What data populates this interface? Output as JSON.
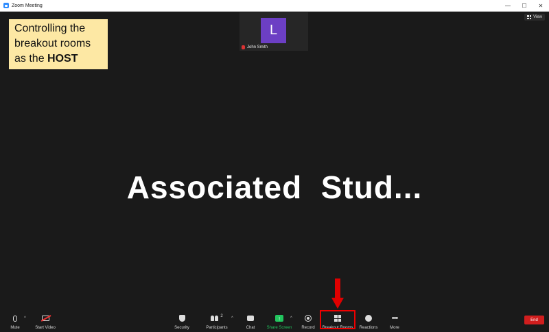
{
  "window": {
    "title": "Zoom Meeting",
    "controls": [
      "—",
      "☐",
      "✕"
    ]
  },
  "view_button": {
    "label": "View"
  },
  "callout": {
    "line1": "Controlling the",
    "line2": "breakout rooms",
    "line3_prefix": "as the ",
    "line3_bold": "HOST"
  },
  "participant_tile": {
    "initial": "L",
    "name": "John Smith"
  },
  "shared_screen": {
    "title": "Associated  Stud..."
  },
  "toolbar": {
    "mute": "Mute",
    "start_video": "Start Video",
    "security": "Security",
    "participants": "Participants",
    "participants_count": "2",
    "chat": "Chat",
    "share_screen": "Share Screen",
    "record": "Record",
    "breakout_rooms": "Breakout Rooms",
    "reactions": "Reactions",
    "more": "More",
    "end": "End",
    "caret": "^"
  },
  "colors": {
    "share_green": "#22c55e",
    "end_red": "#d11e1e",
    "highlight_red": "#e00000",
    "callout_bg": "#fde8a4",
    "avatar_purple": "#6c3fc4"
  }
}
